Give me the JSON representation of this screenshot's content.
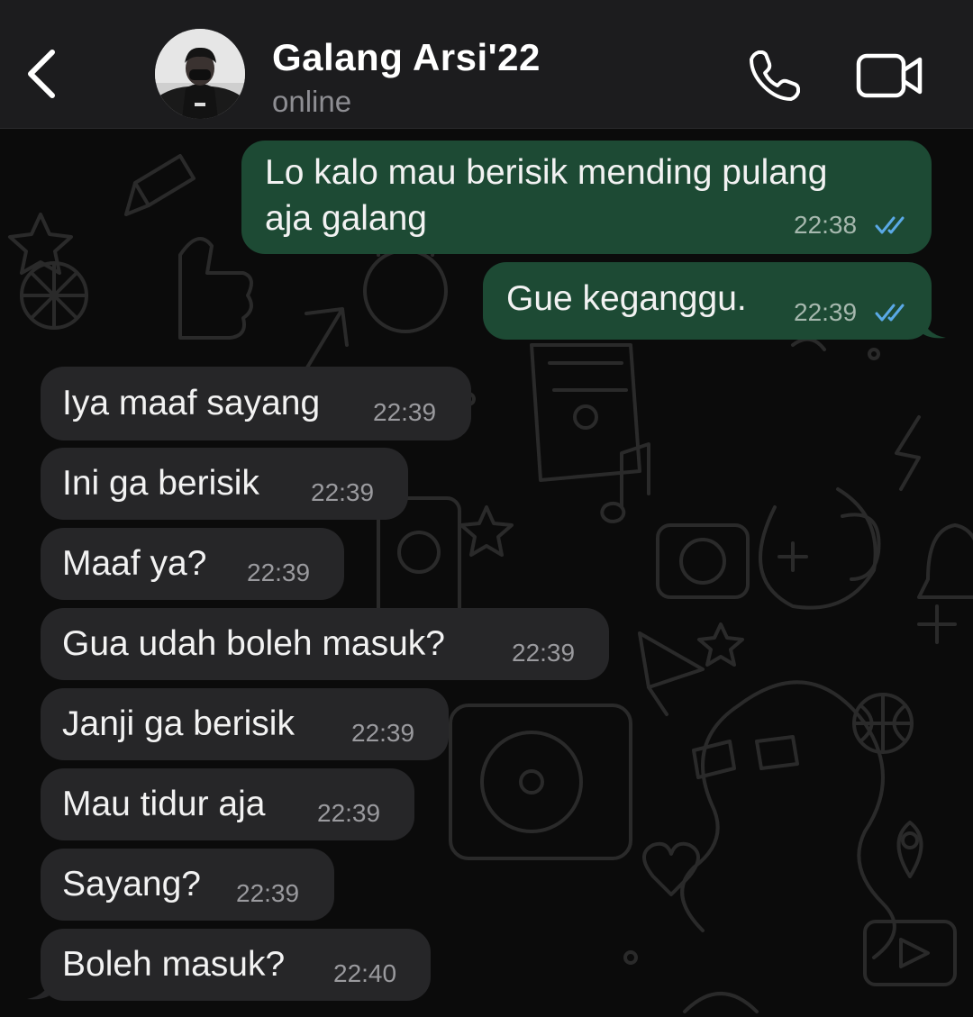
{
  "header": {
    "back_label": "Back",
    "contact_name": "Galang Arsi'22",
    "contact_status": "online"
  },
  "colors": {
    "header_bg": "#1c1c1e",
    "outgoing_bubble": "#1d4a34",
    "incoming_bubble": "#262628",
    "read_ticks": "#5aa9e6"
  },
  "messages": [
    {
      "direction": "outgoing",
      "lines": [
        "Lo kalo mau berisik mending pulang",
        "aja galang"
      ],
      "time": "22:38",
      "status": "read"
    },
    {
      "direction": "outgoing",
      "lines": [
        "Gue keganggu."
      ],
      "time": "22:39",
      "status": "read"
    },
    {
      "direction": "incoming",
      "lines": [
        "Iya maaf sayang"
      ],
      "time": "22:39"
    },
    {
      "direction": "incoming",
      "lines": [
        "Ini ga berisik"
      ],
      "time": "22:39"
    },
    {
      "direction": "incoming",
      "lines": [
        "Maaf ya?"
      ],
      "time": "22:39"
    },
    {
      "direction": "incoming",
      "lines": [
        "Gua udah boleh masuk?"
      ],
      "time": "22:39"
    },
    {
      "direction": "incoming",
      "lines": [
        "Janji ga berisik"
      ],
      "time": "22:39"
    },
    {
      "direction": "incoming",
      "lines": [
        "Mau tidur aja"
      ],
      "time": "22:39"
    },
    {
      "direction": "incoming",
      "lines": [
        "Sayang?"
      ],
      "time": "22:39"
    },
    {
      "direction": "incoming",
      "lines": [
        "Boleh masuk?"
      ],
      "time": "22:40"
    }
  ]
}
